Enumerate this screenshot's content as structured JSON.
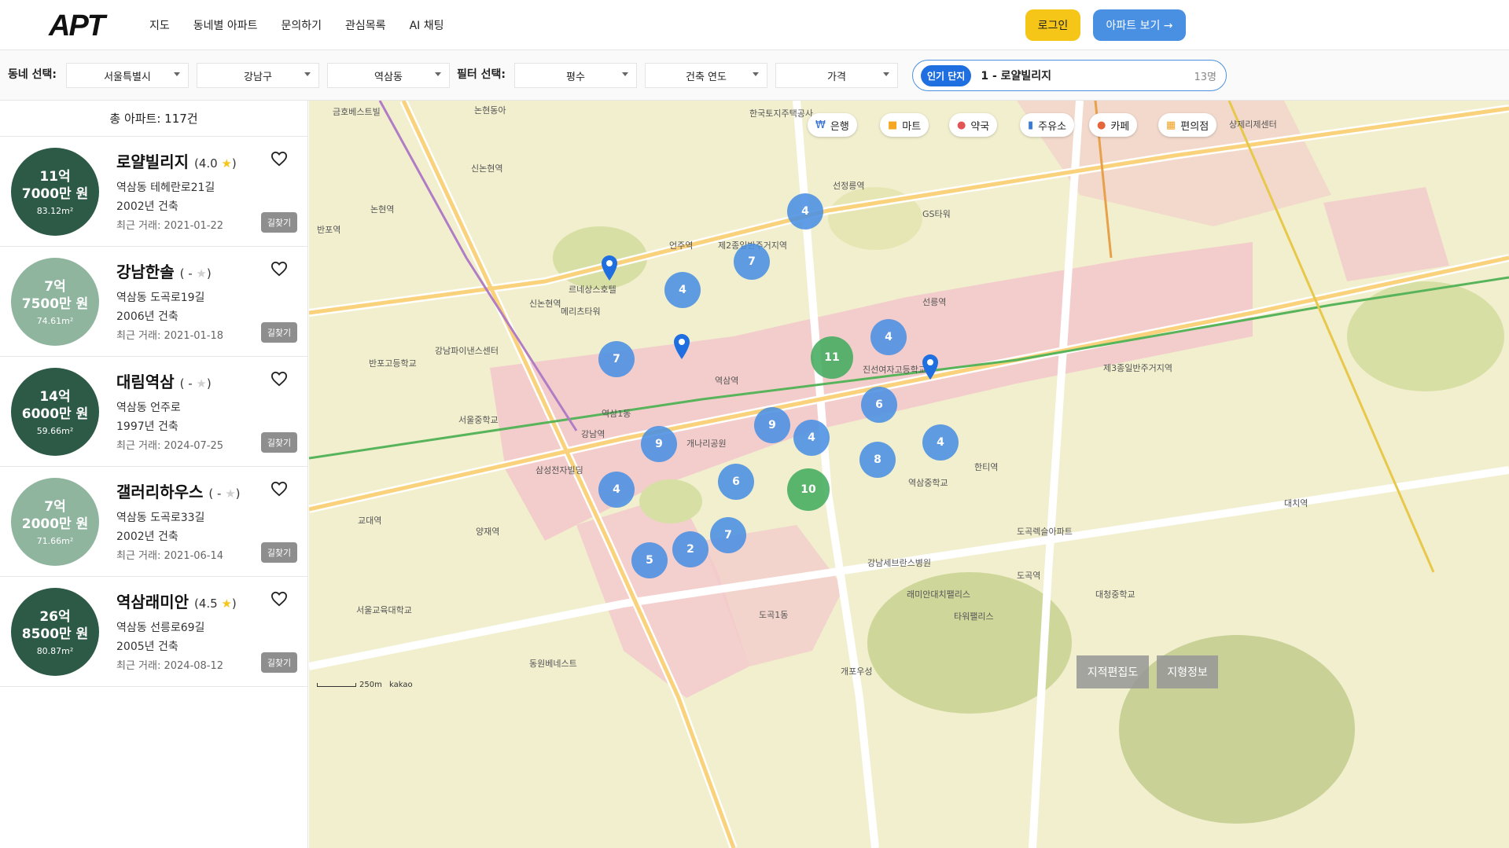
{
  "app": {
    "logo": "APT"
  },
  "nav": {
    "items": [
      "지도",
      "동네별 아파트",
      "문의하기",
      "관심목록",
      "AI 채팅"
    ]
  },
  "header": {
    "login": "로그인",
    "apt_view": "아파트 보기 →"
  },
  "filters": {
    "area_label": "동네 선택:",
    "city": "서울특별시",
    "district": "강남구",
    "dong": "역삼동",
    "filter_label": "필터 선택:",
    "pyeong": "평수",
    "built_year": "건축 연도",
    "price": "가격"
  },
  "popular": {
    "badge": "인기 단지",
    "name": "1 - 로얄빌리지",
    "count": "13명"
  },
  "list": {
    "total": "총 아파트: 117건",
    "road_label": "길찾기",
    "items": [
      {
        "price1": "11억",
        "price2": "7000만 원",
        "area": "83.12m²",
        "name": "로얄빌리지",
        "rating": "(4.0 ",
        "star": "★",
        "rating_end": ")",
        "address": "역삼동 테헤란로21길",
        "year": "2002년 건축",
        "deal": "최근 거래: 2021-01-22",
        "tone": "dark"
      },
      {
        "price1": "7억",
        "price2": "7500만 원",
        "area": "74.61m²",
        "name": "강남한솔",
        "rating": "( - ",
        "star": "★",
        "rating_end": ")",
        "address": "역삼동 도곡로19길",
        "year": "2006년 건축",
        "deal": "최근 거래: 2021-01-18",
        "tone": "light"
      },
      {
        "price1": "14억",
        "price2": "6000만 원",
        "area": "59.66m²",
        "name": "대림역삼",
        "rating": "( - ",
        "star": "★",
        "rating_end": ")",
        "address": "역삼동 언주로",
        "year": "1997년 건축",
        "deal": "최근 거래: 2024-07-25",
        "tone": "dark"
      },
      {
        "price1": "7억",
        "price2": "2000만 원",
        "area": "71.66m²",
        "name": "갤러리하우스",
        "rating": "( - ",
        "star": "★",
        "rating_end": ")",
        "address": "역삼동 도곡로33길",
        "year": "2002년 건축",
        "deal": "최근 거래: 2021-06-14",
        "tone": "light"
      },
      {
        "price1": "26억",
        "price2": "8500만 원",
        "area": "80.87m²",
        "name": "역삼래미안",
        "rating": "(4.5 ",
        "star": "★",
        "rating_end": ")",
        "address": "역삼동 선릉로69길",
        "year": "2005년 건축",
        "deal": "최근 거래: 2024-08-12",
        "tone": "dark"
      }
    ]
  },
  "map": {
    "categories": [
      "은행",
      "마트",
      "약국",
      "주유소",
      "카페",
      "편의점"
    ],
    "clusters": [
      "4",
      "7",
      "4",
      "7",
      "11",
      "4",
      "6",
      "9",
      "4",
      "9",
      "8",
      "4",
      "6",
      "10",
      "4",
      "7",
      "2",
      "5"
    ],
    "buttons": {
      "cadastral": "지적편집도",
      "terrain": "지형정보"
    },
    "scale": "250m",
    "kakao": "kakao",
    "labels": [
      "금호베스트빌",
      "논현동아",
      "한국토지주택공사",
      "샹제리제센터",
      "신논현역",
      "논현역",
      "언주역",
      "선정릉역",
      "반포역",
      "역삼역",
      "선릉역",
      "강남역",
      "한티역",
      "도곡역",
      "교대역",
      "신논현역",
      "양재역",
      "대치역",
      "역삼1동",
      "도곡1동",
      "제2종일반주거지역",
      "제3종일반주거지역",
      "삼성전자빌딩",
      "개나리공원",
      "역삼중학교",
      "진선여자고등학교",
      "서울중학교",
      "대청중학교",
      "반포고등학교",
      "서울교육대학교",
      "강남세브란스병원",
      "도곡렉슬아파트",
      "래미안대치팰리스",
      "타워팰리스",
      "개포우성",
      "동원베네스트",
      "GS타워",
      "르네상스호텔",
      "메리츠타워",
      "강남파이낸스센터"
    ]
  }
}
